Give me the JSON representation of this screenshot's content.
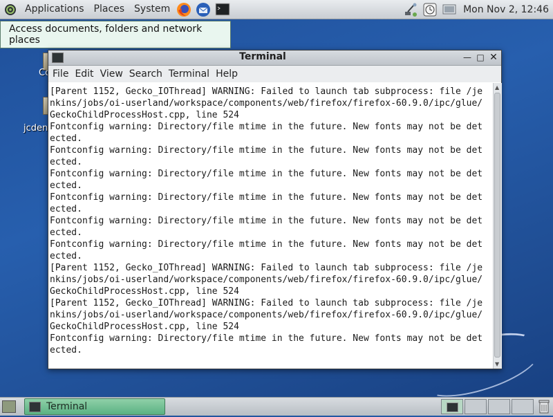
{
  "top_panel": {
    "menus": [
      "Applications",
      "Places",
      "System"
    ],
    "clock": "Mon Nov  2, 12:46"
  },
  "tooltip": {
    "text": "Access documents, folders and network places"
  },
  "desktop": {
    "labels": [
      "Co",
      "jcden"
    ]
  },
  "terminal": {
    "title": "Terminal",
    "menubar": [
      "File",
      "Edit",
      "View",
      "Search",
      "Terminal",
      "Help"
    ],
    "lines": [
      "[Parent 1152, Gecko_IOThread] WARNING: Failed to launch tab subprocess: file /je",
      "nkins/jobs/oi-userland/workspace/components/web/firefox/firefox-60.9.0/ipc/glue/",
      "GeckoChildProcessHost.cpp, line 524",
      "Fontconfig warning: Directory/file mtime in the future. New fonts may not be det",
      "ected.",
      "Fontconfig warning: Directory/file mtime in the future. New fonts may not be det",
      "ected.",
      "Fontconfig warning: Directory/file mtime in the future. New fonts may not be det",
      "ected.",
      "Fontconfig warning: Directory/file mtime in the future. New fonts may not be det",
      "ected.",
      "Fontconfig warning: Directory/file mtime in the future. New fonts may not be det",
      "ected.",
      "Fontconfig warning: Directory/file mtime in the future. New fonts may not be det",
      "ected.",
      "[Parent 1152, Gecko_IOThread] WARNING: Failed to launch tab subprocess: file /je",
      "nkins/jobs/oi-userland/workspace/components/web/firefox/firefox-60.9.0/ipc/glue/",
      "GeckoChildProcessHost.cpp, line 524",
      "[Parent 1152, Gecko_IOThread] WARNING: Failed to launch tab subprocess: file /je",
      "nkins/jobs/oi-userland/workspace/components/web/firefox/firefox-60.9.0/ipc/glue/",
      "GeckoChildProcessHost.cpp, line 524",
      "Fontconfig warning: Directory/file mtime in the future. New fonts may not be det",
      "ected."
    ]
  },
  "taskbar": {
    "task_label": "Terminal"
  },
  "icons": {
    "menu_logo": "openindiana-logo-icon",
    "firefox": "firefox-icon",
    "thunderbird": "thunderbird-icon",
    "terminal_launcher": "terminal-icon",
    "network": "network-icon",
    "clock_app": "clock-icon",
    "display": "display-icon",
    "trash": "trash-icon"
  }
}
